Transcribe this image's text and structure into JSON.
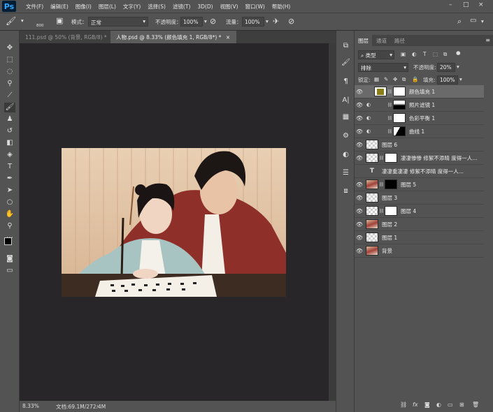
{
  "menubar": {
    "logo": "Ps",
    "items": [
      "文件(F)",
      "编辑(E)",
      "图像(I)",
      "图层(L)",
      "文字(Y)",
      "选择(S)",
      "滤镜(T)",
      "3D(D)",
      "视图(V)",
      "窗口(W)",
      "帮助(H)"
    ],
    "minimize": "–",
    "maximize": "□",
    "close": "×"
  },
  "options": {
    "brush_size": "800",
    "mode_label": "模式：",
    "mode_value": "正常",
    "opacity_label": "不透明度：",
    "opacity_value": "100%",
    "flow_label": "流量：",
    "flow_value": "100%"
  },
  "tabs": [
    {
      "label": "111.psd @ 50% (背景, RGB/8) *",
      "close": "×"
    },
    {
      "label": "人物.psd @ 8.33% (颜色填充 1, RGB/8*) *",
      "close": "×"
    }
  ],
  "status": {
    "zoom": "8.33%",
    "doc": "文档:69.1M/272.4M"
  },
  "layers_panel": {
    "tabs": [
      "图层",
      "通道",
      "路径"
    ],
    "filter_kind": "类型",
    "blend_mode": "排除",
    "opacity_label": "不透明度:",
    "opacity_value": "20%",
    "lock_label": "锁定:",
    "fill_label": "填充:",
    "fill_value": "100%",
    "layers": [
      {
        "name": "颜色填充 1"
      },
      {
        "name": "照片滤镜 1"
      },
      {
        "name": "色彩平衡 1"
      },
      {
        "name": "曲线 1"
      },
      {
        "name": "图层 6"
      },
      {
        "name": "凄凄惨惨 修絮不添晴 度得一人..."
      },
      {
        "name": "凄凄重凄凄 修絮不添晴 度得一人..."
      },
      {
        "name": "图层 5"
      },
      {
        "name": "图层 3"
      },
      {
        "name": "图层 4"
      },
      {
        "name": "图层 2"
      },
      {
        "name": "图层 1"
      },
      {
        "name": "背景"
      }
    ],
    "footer": "fx"
  },
  "colors": {
    "fill_swatch": "#8a7e15",
    "ps_blue": "#31a8ff"
  }
}
